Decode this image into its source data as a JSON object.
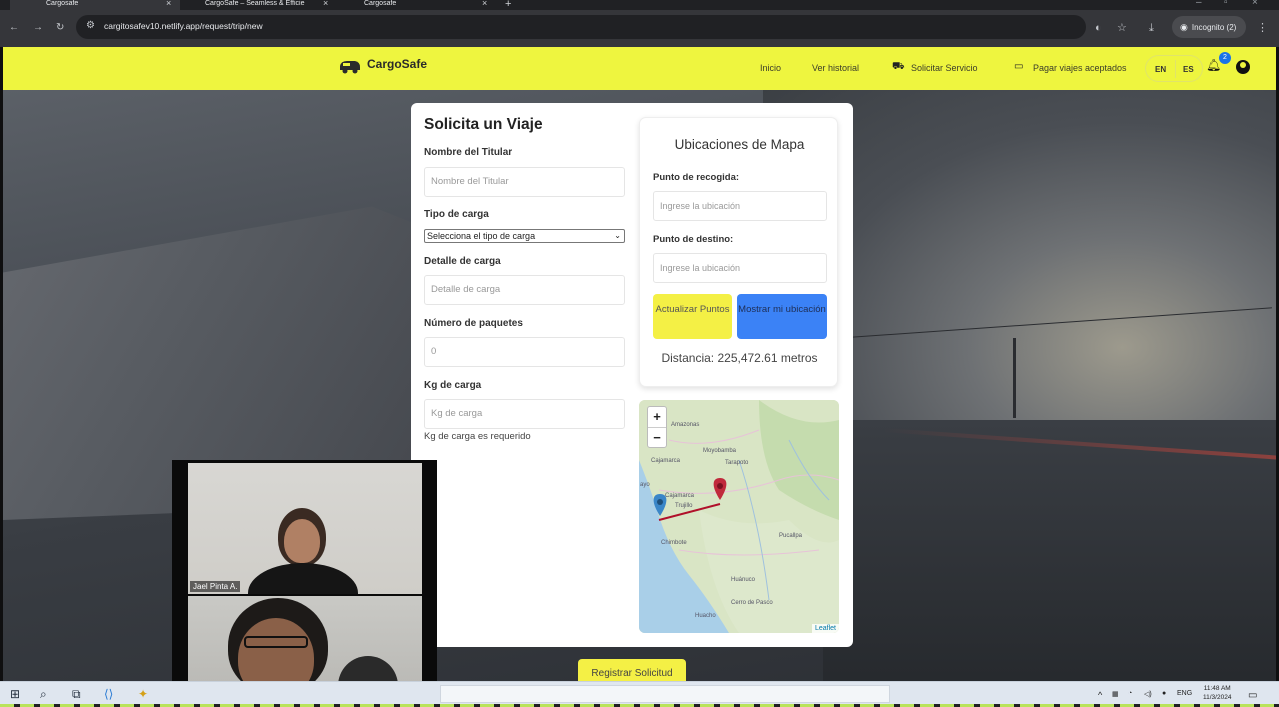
{
  "browser": {
    "tabs": [
      {
        "label": "Cargosafe"
      },
      {
        "label": "CargoSafe – Seamless & Efficie"
      },
      {
        "label": "Cargosafe"
      }
    ],
    "url": "cargitosafev10.netlify.app/request/trip/new",
    "incognito_label": "Incognito (2)"
  },
  "navbar": {
    "brand": "CargoSafe",
    "links": {
      "inicio": "Inicio",
      "historial": "Ver historial",
      "solicitar": "Solicitar Servicio",
      "pagar": "Pagar viajes aceptados"
    },
    "lang_en": "EN",
    "lang_es": "ES",
    "notification_count": "2",
    "accent_color": "#eef53f"
  },
  "form": {
    "title": "Solicita un Viaje",
    "holder_label": "Nombre del Titular",
    "holder_placeholder": "Nombre del Titular",
    "cargo_type_label": "Tipo de carga",
    "cargo_type_selected": "Selecciona el tipo de carga",
    "cargo_detail_label": "Detalle de carga",
    "cargo_detail_placeholder": "Detalle de carga",
    "packages_label": "Número de paquetes",
    "packages_value": "0",
    "kg_label": "Kg de carga",
    "kg_placeholder": "Kg de carga",
    "kg_error": "Kg de carga es requerido",
    "submit_label": "Registrar Solicitud"
  },
  "map_panel": {
    "title": "Ubicaciones de Mapa",
    "pickup_label": "Punto de recogida:",
    "pickup_placeholder": "Ingrese la ubicación",
    "destination_label": "Punto de destino:",
    "destination_placeholder": "Ingrese la ubicación",
    "update_button": "Actualizar Puntos",
    "location_button": "Mostrar mi ubicación",
    "distance_text": "Distancia: 225,472.61 metros"
  },
  "map": {
    "zoom_in": "+",
    "zoom_out": "−",
    "attribution": "Leaflet",
    "places": {
      "amazonas": "Amazonas",
      "moyobamba": "Moyobamba",
      "tarapoto": "Tarapoto",
      "cajamarca_region": "Cajamarca",
      "cajamarca_city": "Cajamarca",
      "trujillo": "Trujillo",
      "chimbote": "Chimbote",
      "pucallpa": "Pucallpa",
      "huanuco": "Huánuco",
      "cerro_de_pasco": "Cerro de Pasco",
      "huacho": "Huacho",
      "chiclayo_partial": "ayo"
    },
    "pickup_marker_color": "#3a86c8",
    "destination_marker_color": "#c0293b",
    "route_color": "#b0102a"
  },
  "video_call": {
    "participant_name": "Jael Pinta A."
  },
  "taskbar": {
    "lang": "ENG",
    "time": "11:48 AM",
    "date": "11/3/2024"
  }
}
